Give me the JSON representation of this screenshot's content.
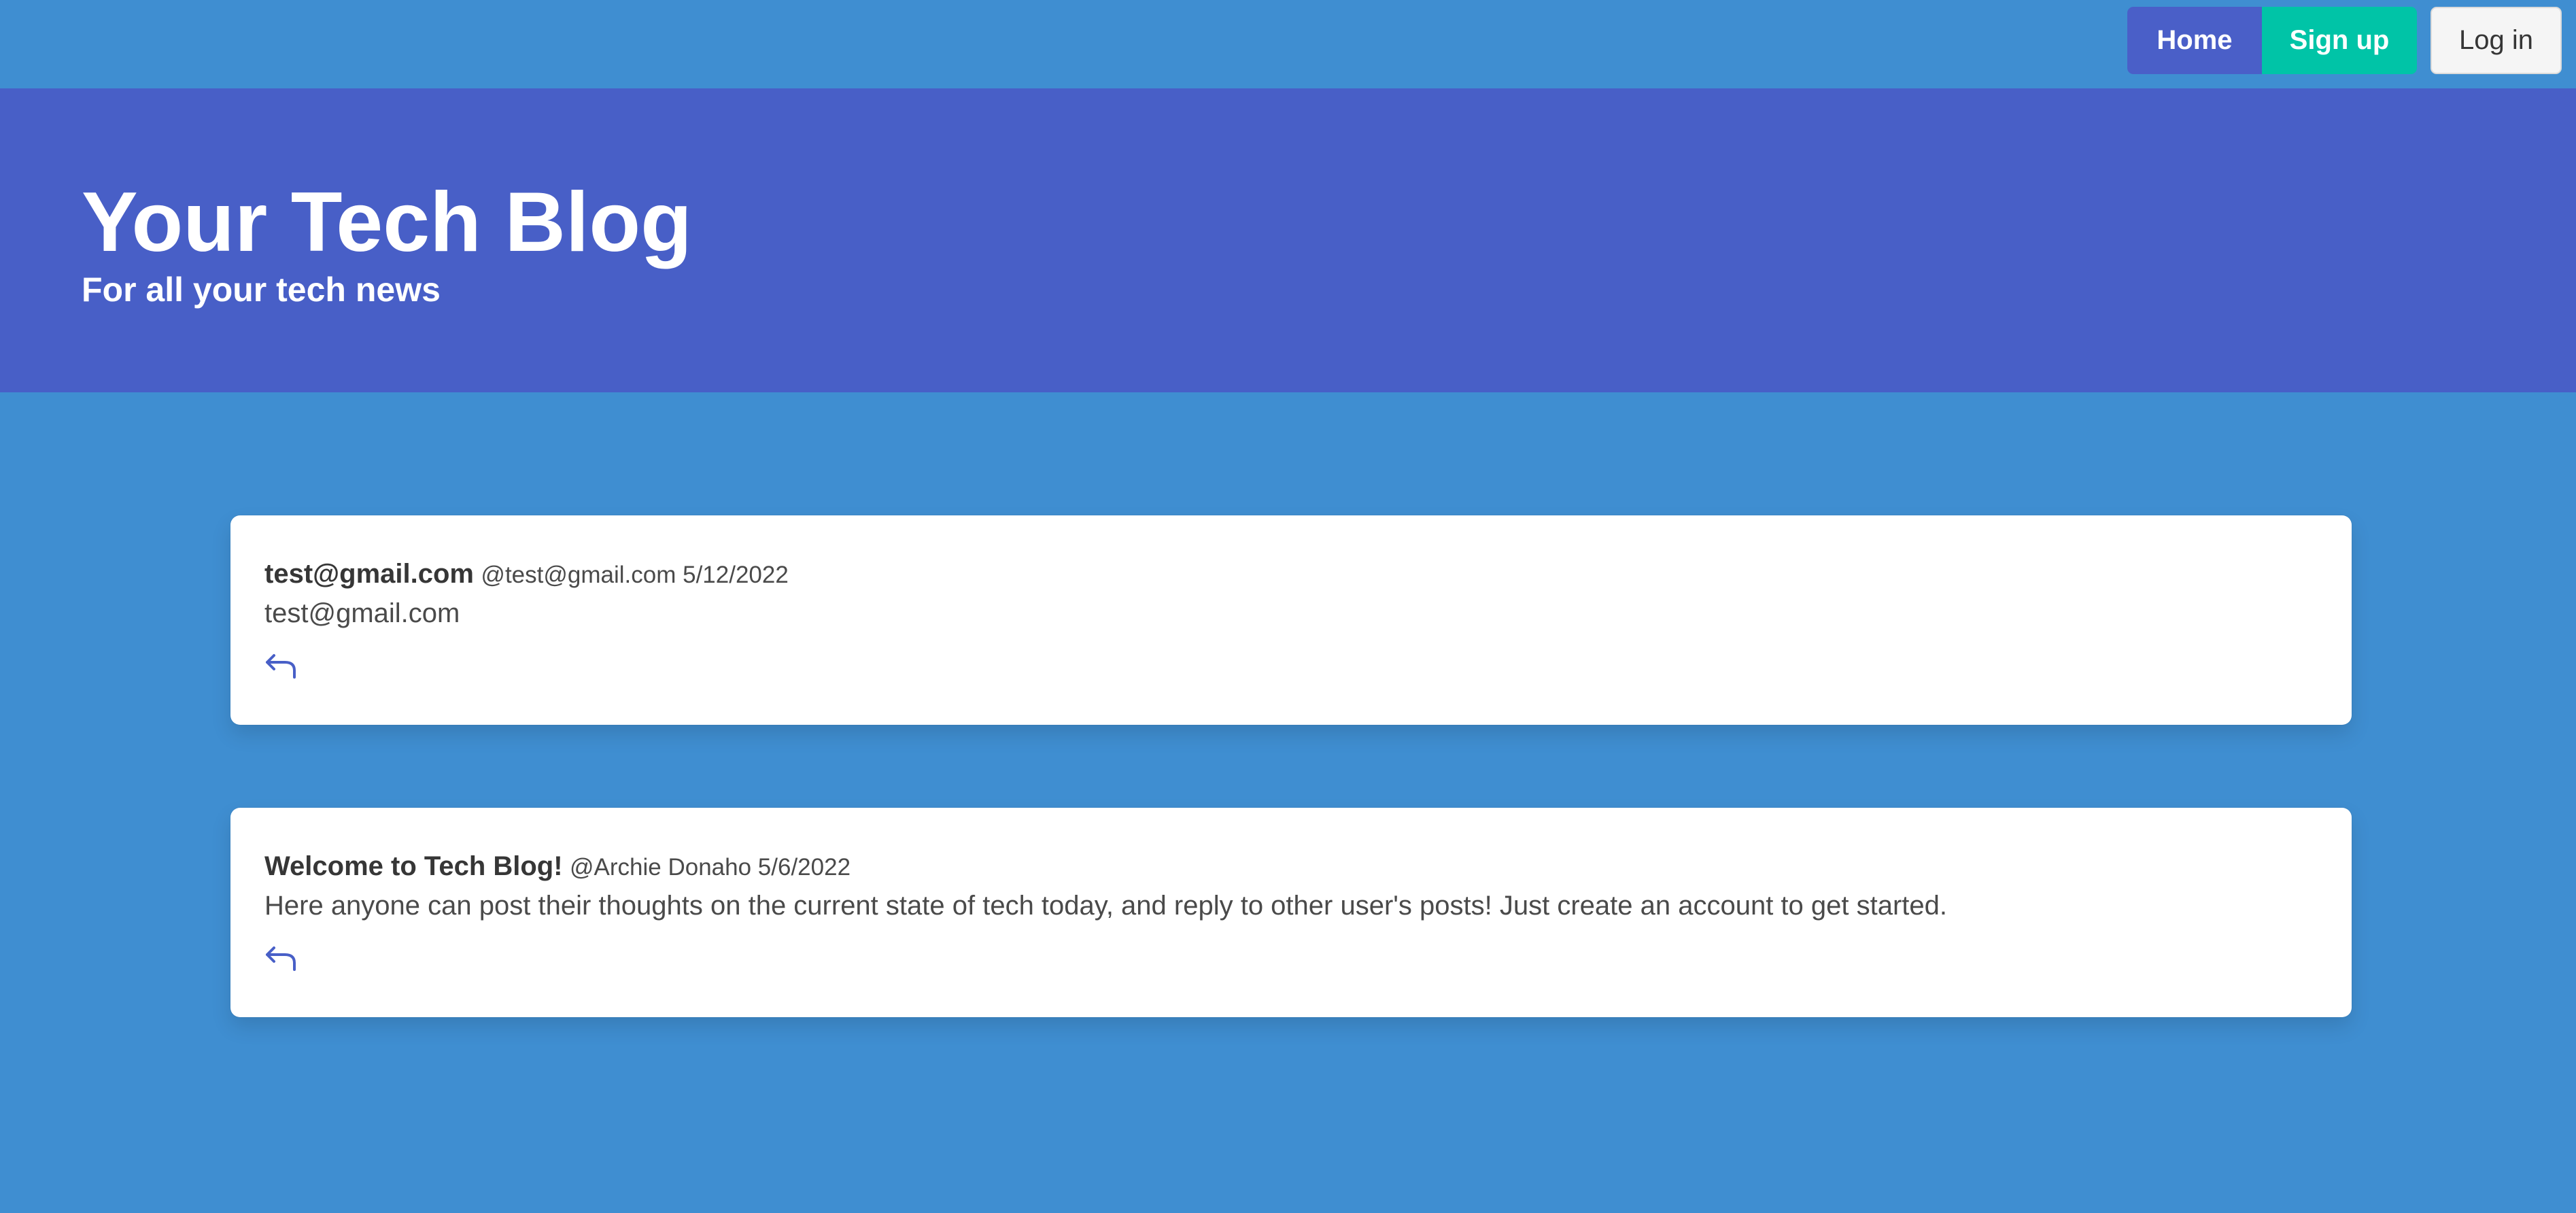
{
  "nav": {
    "home_label": "Home",
    "signup_label": "Sign up",
    "login_label": "Log in"
  },
  "hero": {
    "title": "Your Tech Blog",
    "subtitle": "For all your tech news"
  },
  "posts": [
    {
      "title": "test@gmail.com",
      "meta": "@test@gmail.com 5/12/2022",
      "body": "test@gmail.com",
      "action_icon": "reply-icon"
    },
    {
      "title": "Welcome to Tech Blog!",
      "meta": "@Archie Donaho 5/6/2022",
      "body": "Here anyone can post their thoughts on the current state of tech today, and reply to other user's posts! Just create an account to get started.",
      "action_icon": "reply-icon"
    }
  ],
  "colors": {
    "page_background": "#3f8ed1",
    "hero_background": "#485fc7",
    "home_button": "#4a5fc8",
    "signup_button": "#00c4a7",
    "reply_icon": "#485fc7"
  }
}
